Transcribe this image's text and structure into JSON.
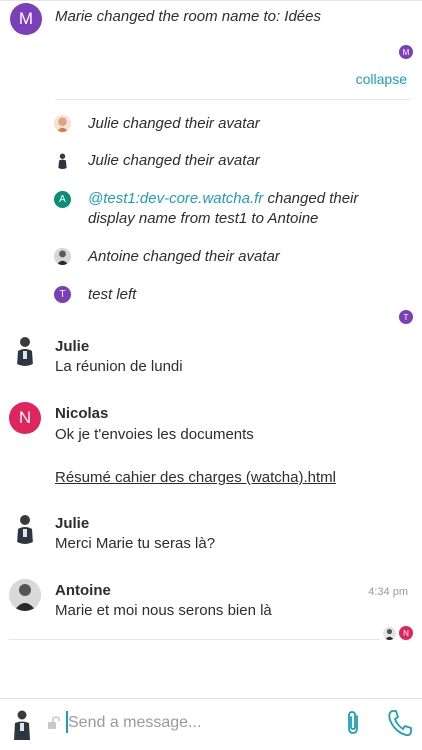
{
  "room_name_event": {
    "avatar_letter": "M",
    "text": "Marie changed the room name to: Idées",
    "read_receipt_letter": "M"
  },
  "collapse_label": "collapse",
  "membership_events": [
    {
      "text": "Julie changed their avatar"
    },
    {
      "text": "Julie changed their avatar"
    },
    {
      "avatar_letter": "A",
      "link": "@test1:dev-core.watcha.fr",
      "line1_rest": " changed their",
      "line2": "display name from test1 to Antoine"
    },
    {
      "text": "Antoine changed their avatar"
    },
    {
      "avatar_letter": "T",
      "text": "test left"
    }
  ],
  "membership_read_receipt_letter": "T",
  "messages": [
    {
      "sender": "Julie",
      "lines": [
        "La réunion de lundi"
      ]
    },
    {
      "sender": "Nicolas",
      "avatar_letter": "N",
      "lines": [
        "Ok je t'envoies les documents"
      ],
      "attachment": "Résumé cahier des charges (watcha).html"
    },
    {
      "sender": "Julie",
      "lines": [
        "Merci Marie tu seras là?"
      ]
    },
    {
      "sender": "Antoine",
      "lines": [
        "Marie et moi nous serons bien là"
      ],
      "timestamp": "4:34 pm"
    }
  ],
  "last_read_receipt_letter": "N",
  "composer": {
    "placeholder": "Send a message..."
  },
  "colors": {
    "accent": "#1e9eb4",
    "purple": "#7b3fb8",
    "pink": "#e0245e",
    "teal": "#0a8f75"
  },
  "icons": {
    "attach": "paperclip-icon",
    "call": "phone-icon",
    "encryption": "unlocked-icon"
  }
}
